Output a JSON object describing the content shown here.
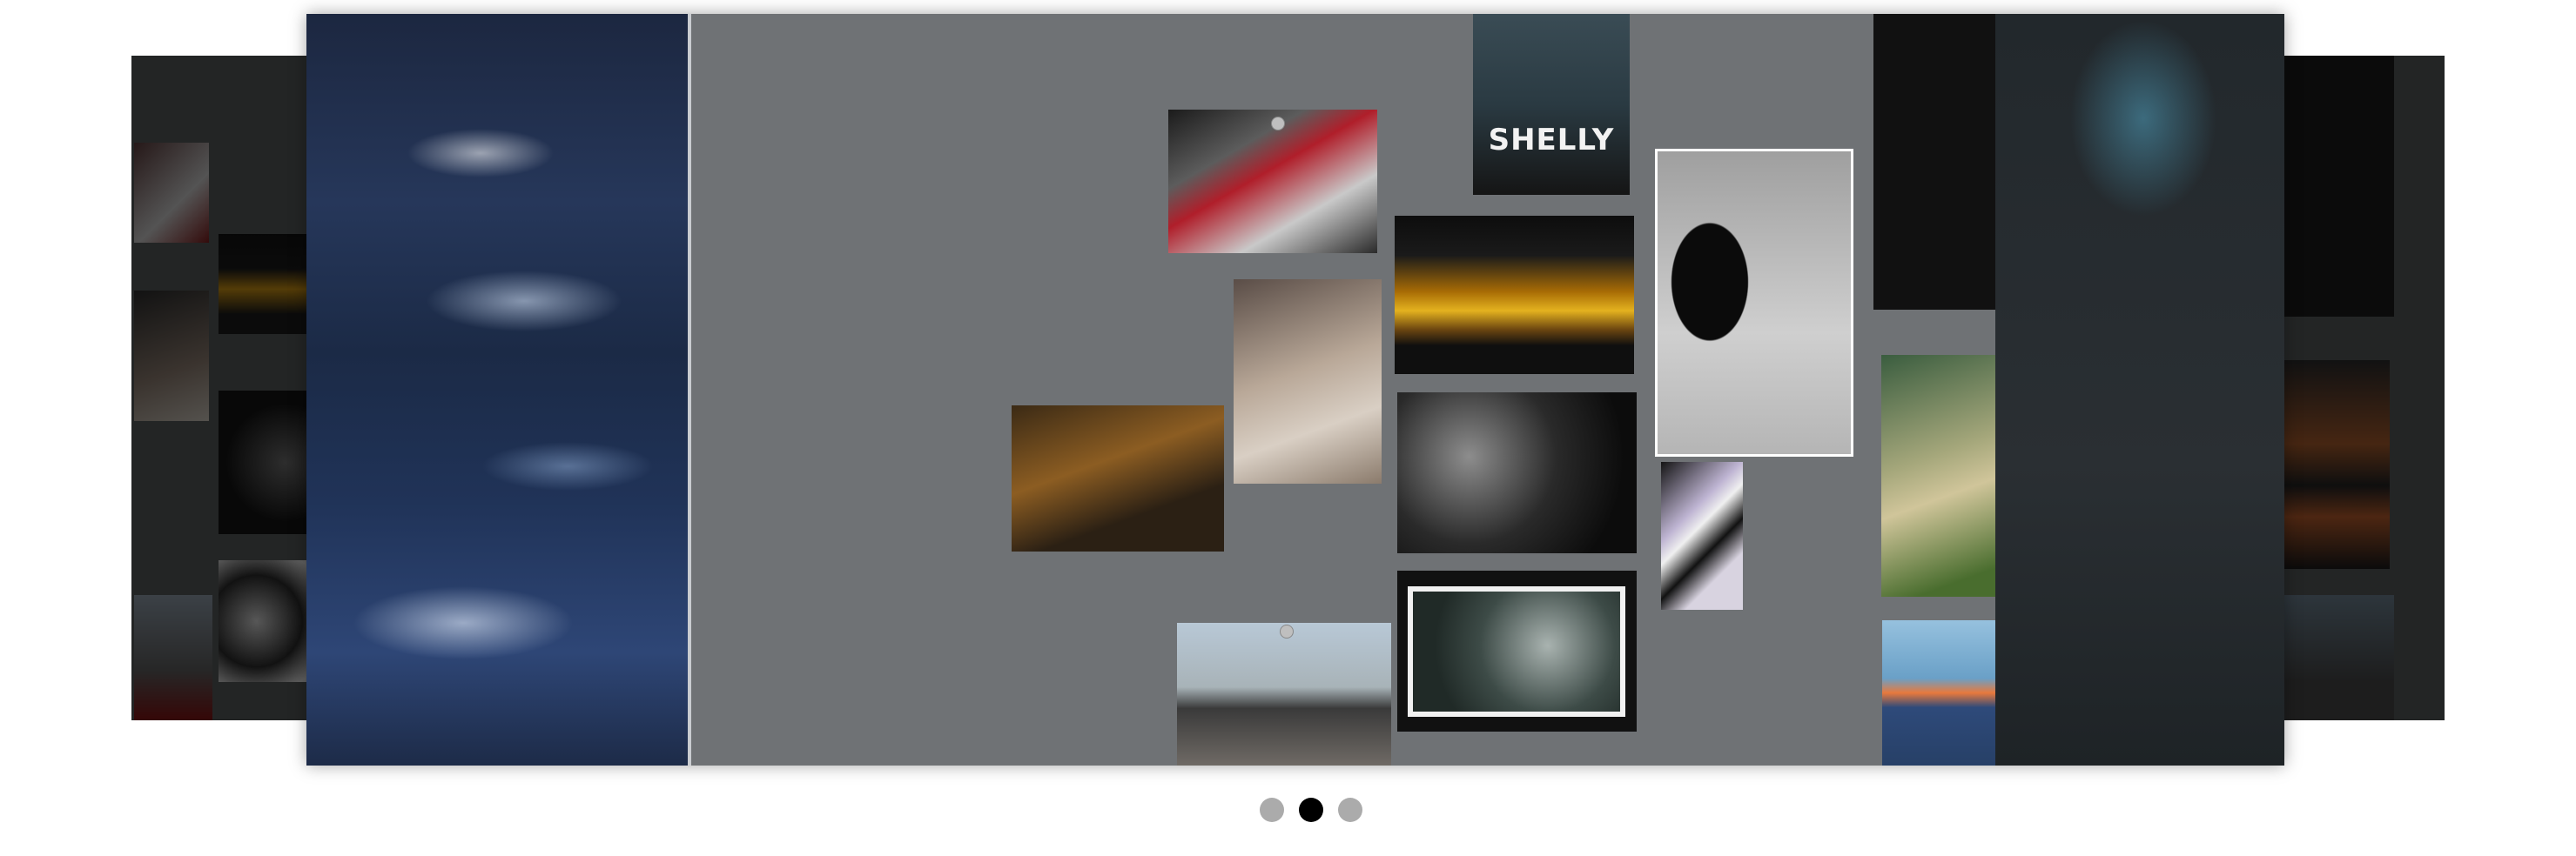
{
  "carousel": {
    "slides": [
      {
        "id": "prev",
        "description_icon": "photo-collage"
      },
      {
        "id": "current",
        "description_icon": "photo-collage"
      },
      {
        "id": "next",
        "description_icon": "photo-collage"
      }
    ],
    "active_index": 1,
    "photo_caption": "SHELLY",
    "pagination": {
      "count": 3,
      "active": 1
    }
  },
  "colors": {
    "dot_inactive": "#ababab",
    "dot_active": "#000000",
    "board": "#6f7275"
  }
}
